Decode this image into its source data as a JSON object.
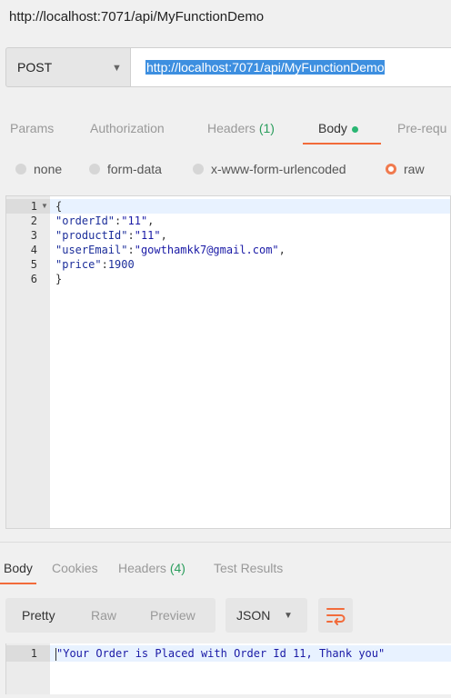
{
  "window": {
    "title": "http://localhost:7071/api/MyFunctionDemo"
  },
  "request": {
    "method": "POST",
    "url": "http://localhost:7071/api/MyFunctionDemo"
  },
  "request_tabs": [
    {
      "label": "Params"
    },
    {
      "label": "Authorization"
    },
    {
      "label": "Headers",
      "count": "(1)"
    },
    {
      "label": "Body",
      "active": true
    },
    {
      "label": "Pre-requ"
    }
  ],
  "body_types": [
    {
      "label": "none",
      "selected": false
    },
    {
      "label": "form-data",
      "selected": false
    },
    {
      "label": "x-www-form-urlencoded",
      "selected": false
    },
    {
      "label": "raw",
      "selected": true
    }
  ],
  "body_lines": [
    {
      "n": "1",
      "text": "{"
    },
    {
      "n": "2",
      "key": "\"orderId\"",
      "value": "\"11\"",
      "tail": ","
    },
    {
      "n": "3",
      "key": "\"productId\"",
      "value": "\"11\"",
      "tail": ","
    },
    {
      "n": "4",
      "key": "\"userEmail\"",
      "value": "\"gowthamkk7@gmail.com\"",
      "tail": ","
    },
    {
      "n": "5",
      "key": "\"price\"",
      "value": "1900",
      "tail": ""
    },
    {
      "n": "6",
      "text": "}"
    }
  ],
  "response_tabs": [
    {
      "label": "Body",
      "active": true
    },
    {
      "label": "Cookies"
    },
    {
      "label": "Headers",
      "count": "(4)"
    },
    {
      "label": "Test Results"
    }
  ],
  "view_modes": [
    "Pretty",
    "Raw",
    "Preview"
  ],
  "format": "JSON",
  "icons": {
    "wrap": "wrap-lines-icon",
    "caret": "chevron-down-icon",
    "fold": "fold-arrow-icon"
  },
  "colors": {
    "accent": "#f26b3a",
    "active_dot": "#2ab673",
    "url_highlight": "#3d8fe0"
  },
  "response_lines": [
    {
      "n": "1",
      "text": "\"Your Order is Placed with Order Id 11, Thank you\""
    }
  ]
}
